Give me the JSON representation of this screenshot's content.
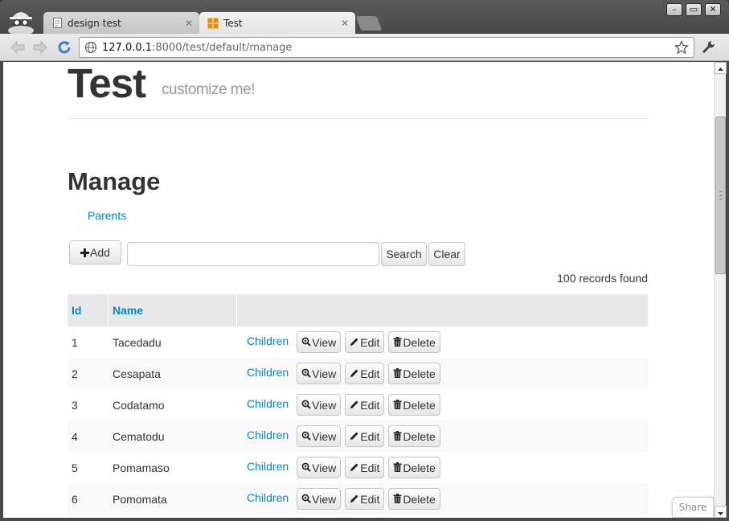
{
  "browser": {
    "tabs": [
      {
        "title": "design test",
        "icon": "page-icon"
      },
      {
        "title": "Test",
        "icon": "web2py-icon"
      }
    ],
    "url_host": "127.0.0.1",
    "url_path": ":8000/test/default/manage",
    "window_controls": [
      "minimize",
      "maximize",
      "close"
    ]
  },
  "site": {
    "title": "Test",
    "tagline": "customize me!"
  },
  "page": {
    "heading": "Manage",
    "parents_link": "Parents",
    "add_label": "Add",
    "search_label": "Search",
    "clear_label": "Clear",
    "records_found": "100 records found",
    "share_label": "Share"
  },
  "grid": {
    "columns": [
      "Id",
      "Name",
      ""
    ],
    "children_label": "Children",
    "view_label": "View",
    "edit_label": "Edit",
    "delete_label": "Delete",
    "rows": [
      {
        "id": "1",
        "name": "Tacedadu"
      },
      {
        "id": "2",
        "name": "Cesapata"
      },
      {
        "id": "3",
        "name": "Codatamo"
      },
      {
        "id": "4",
        "name": "Cematodu"
      },
      {
        "id": "5",
        "name": "Pomamaso"
      },
      {
        "id": "6",
        "name": "Pomomata"
      }
    ]
  },
  "colors": {
    "link": "#0088cc",
    "header_bg": "#e8e8e8",
    "text": "#333333"
  }
}
